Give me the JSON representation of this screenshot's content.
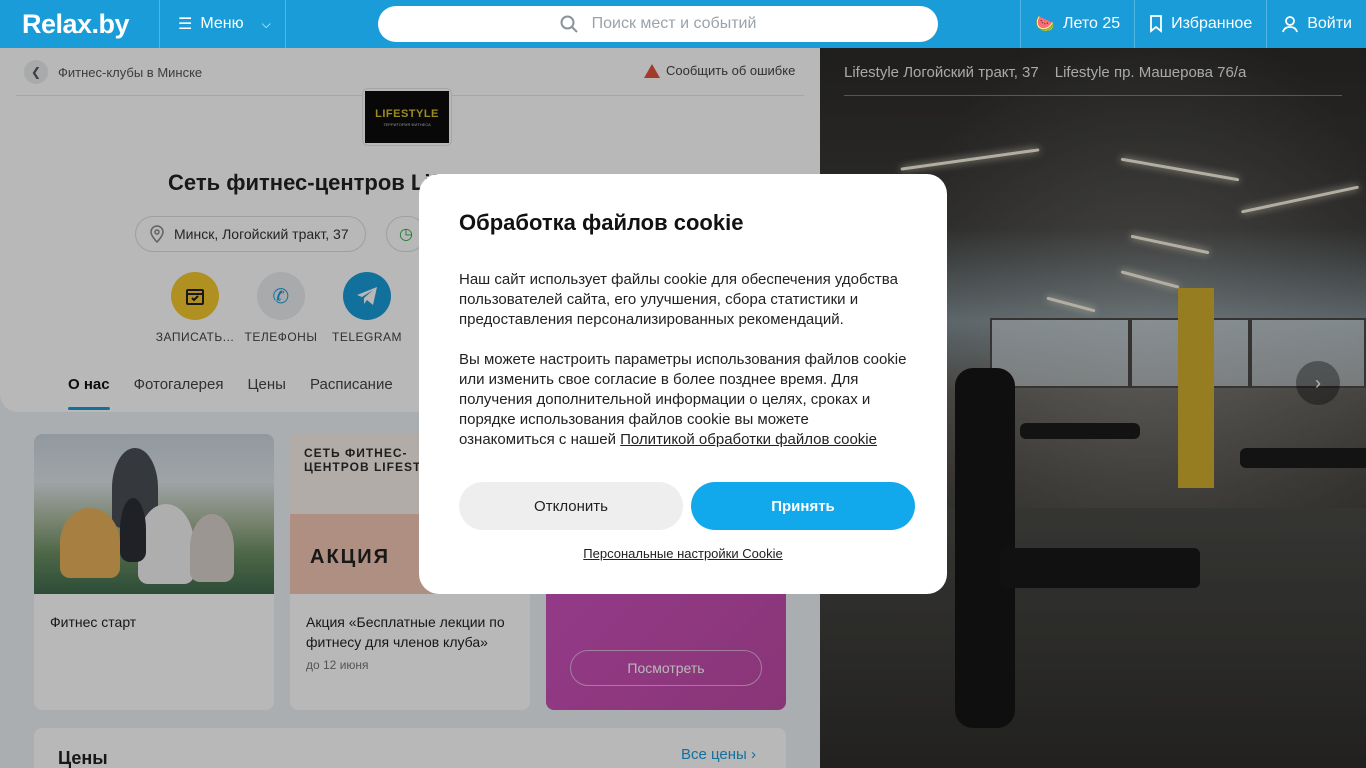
{
  "header": {
    "logo": "Relax.by",
    "menu_label": "Меню",
    "search_placeholder": "Поиск мест и событий",
    "summer_label": "Лето 25",
    "favorites_label": "Избранное",
    "login_label": "Войти",
    "brand_color": "#1a9cd9"
  },
  "breadcrumb": {
    "label": "Фитнес-клубы в Минске"
  },
  "report_error": "Сообщить об ошибке",
  "club": {
    "logo_text": "LIFESTYLE",
    "logo_subtext": "ТЕРРИТОРИЯ ФИТНЕСА",
    "title": "Сеть фитнес-центров Lifestyle",
    "address": "Минск, Логойский тракт, 37"
  },
  "actions": [
    {
      "label": "ЗАПИСАТЬ...",
      "icon": "calendar-icon",
      "color": "#f3c82d"
    },
    {
      "label": "ТЕЛЕФОНЫ",
      "icon": "phone-icon",
      "color": "#e9ecef"
    },
    {
      "label": "TELEGRAM",
      "icon": "telegram-icon",
      "color": "#1a9cd9"
    }
  ],
  "tabs": [
    "О нас",
    "Фотогалерея",
    "Цены",
    "Расписание"
  ],
  "cards": [
    {
      "title": "Фитнес старт"
    },
    {
      "title": "Акция «Бесплатные лекции по фитнесу для членов клуба»",
      "subtitle": "до 12 июня",
      "promo_text": "СЕТЬ ФИТНЕС-ЦЕНТРОВ LIFESTYLE",
      "promo_badge": "АКЦИЯ"
    },
    {
      "button": "Посмотреть"
    }
  ],
  "prices": {
    "heading": "Цены",
    "all_link": "Все цены"
  },
  "gallery": {
    "tabs": [
      "Lifestyle Логойский тракт, 37",
      "Lifestyle пр. Машерова 76/а"
    ]
  },
  "cookie": {
    "title": "Обработка файлов cookie",
    "paragraph1": "Наш сайт использует файлы cookie для обеспечения удобства пользователей сайта, его улучшения, сбора статистики и предоставления персонализированных рекомендаций.",
    "paragraph2": "Вы можете настроить параметры использования файлов cookie или изменить свое согласие в более позднее время. Для получения дополнительной информации о целях, сроках и порядке использования файлов cookie вы можете ознакомиться с нашей",
    "policy_link": "Политикой обработки файлов cookie",
    "decline": "Отклонить",
    "accept": "Принять",
    "personal_settings": "Персональные настройки Cookie",
    "accept_color": "#11a9ec"
  }
}
